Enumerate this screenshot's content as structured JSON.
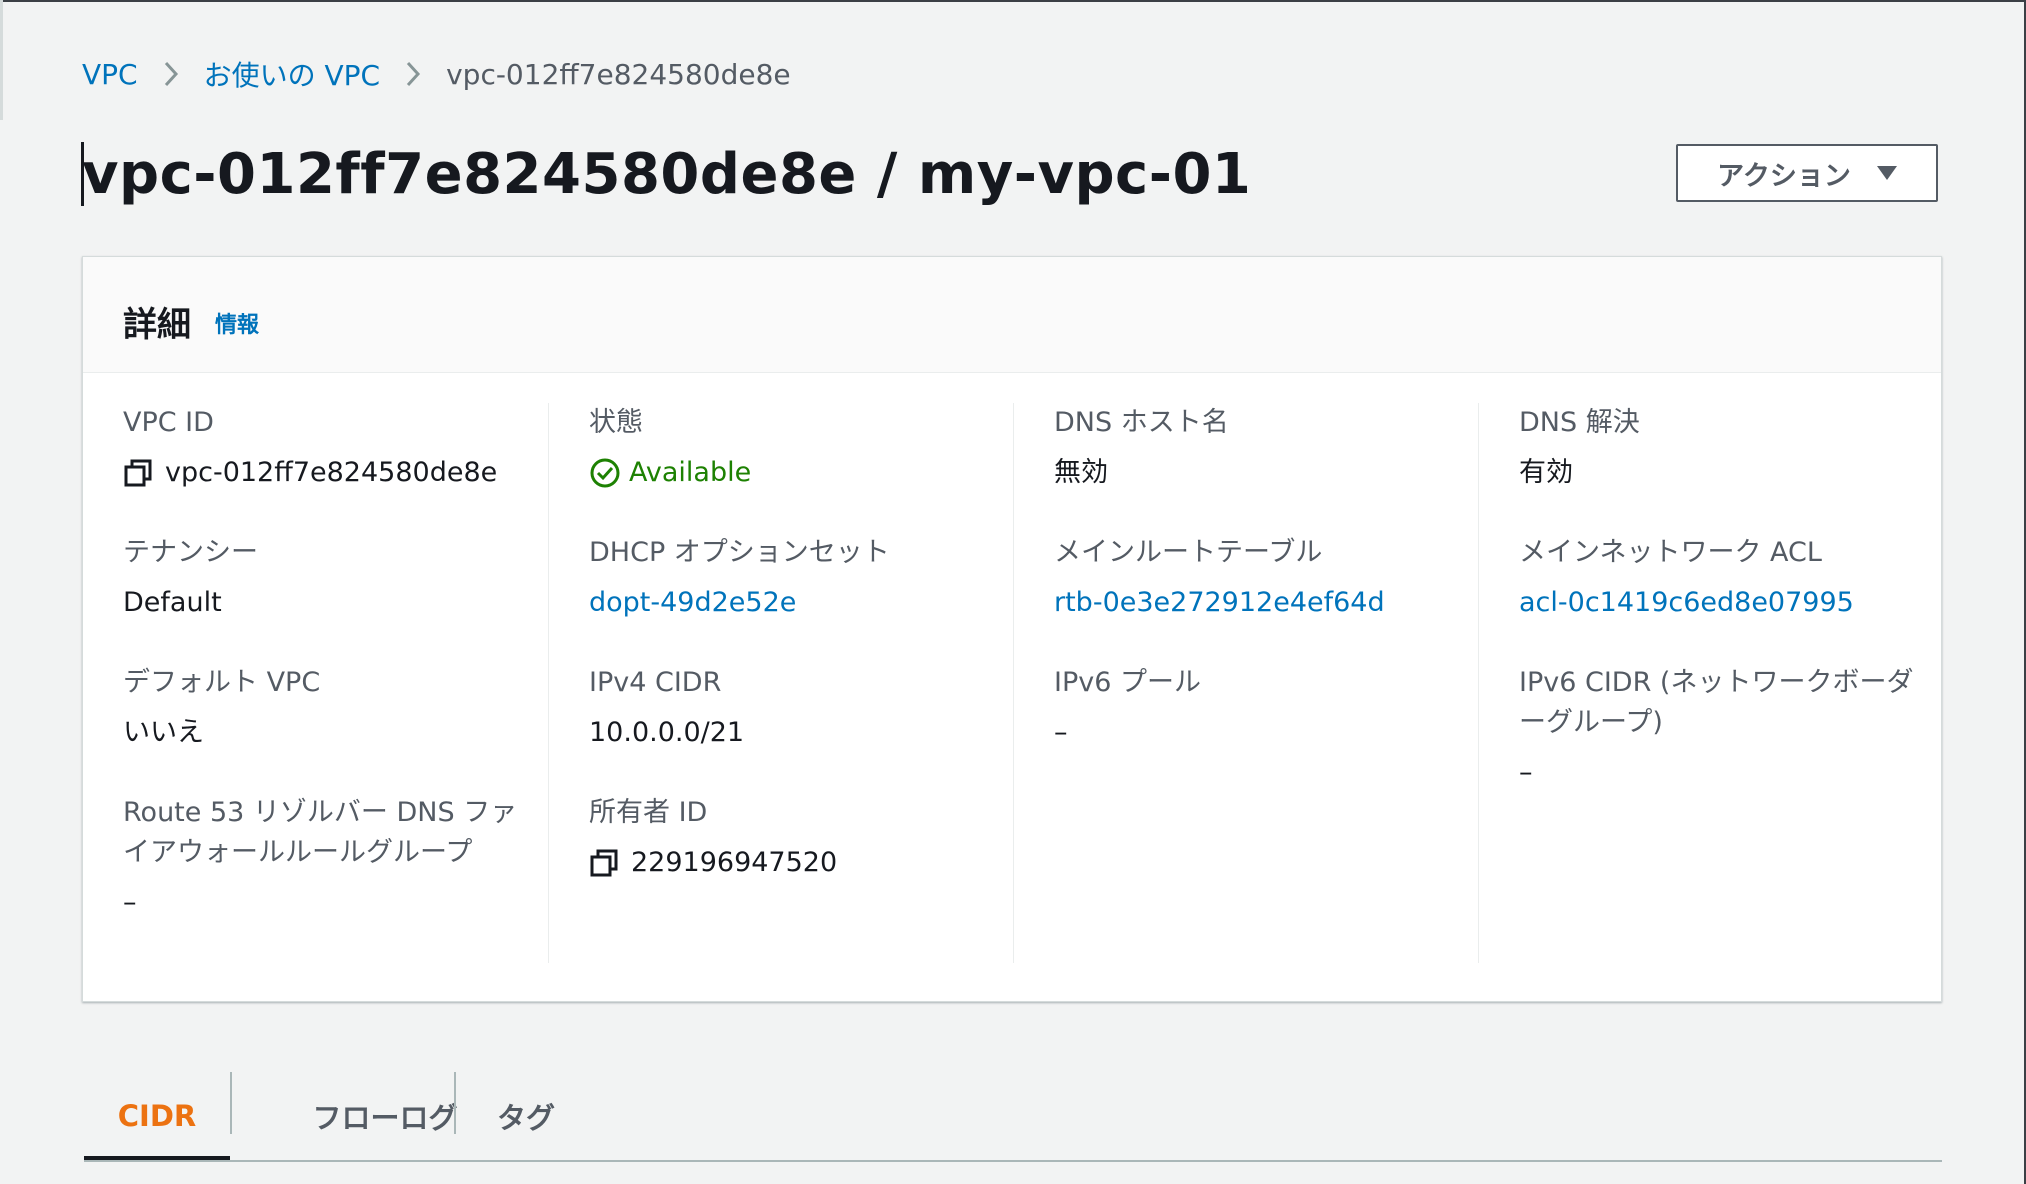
{
  "breadcrumb": {
    "items": [
      "VPC",
      "お使いの VPC"
    ],
    "current": "vpc-012ff7e824580de8e"
  },
  "page": {
    "title": "vpc-012ff7e824580de8e / my-vpc-01",
    "actions_label": "アクション"
  },
  "details": {
    "title": "詳細",
    "info_label": "情報",
    "fields": {
      "vpc_id": {
        "label": "VPC ID",
        "value": "vpc-012ff7e824580de8e"
      },
      "state": {
        "label": "状態",
        "value": "Available"
      },
      "dns_hostnames": {
        "label": "DNS ホスト名",
        "value": "無効"
      },
      "dns_resolution": {
        "label": "DNS 解決",
        "value": "有効"
      },
      "tenancy": {
        "label": "テナンシー",
        "value": "Default"
      },
      "dhcp_options": {
        "label": "DHCP オプションセット",
        "value": "dopt-49d2e52e"
      },
      "main_route_table": {
        "label": "メインルートテーブル",
        "value": "rtb-0e3e272912e4ef64d"
      },
      "main_network_acl": {
        "label": "メインネットワーク ACL",
        "value": "acl-0c1419c6ed8e07995"
      },
      "default_vpc": {
        "label": "デフォルト VPC",
        "value": "いいえ"
      },
      "ipv4_cidr": {
        "label": "IPv4 CIDR",
        "value": "10.0.0.0/21"
      },
      "ipv6_pool": {
        "label": "IPv6 プール",
        "value": "–"
      },
      "ipv6_cidr": {
        "label": "IPv6 CIDR (ネットワークボーダーグループ)",
        "value": "–"
      },
      "route53_firewall": {
        "label": "Route 53 リゾルバー DNS ファイアウォールルールグループ",
        "value": "–"
      },
      "owner_id": {
        "label": "所有者 ID",
        "value": "229196947520"
      }
    }
  },
  "tabs": [
    {
      "label": "CIDR",
      "active": true
    },
    {
      "label": "フローログ",
      "active": false
    },
    {
      "label": "タグ",
      "active": false
    }
  ],
  "colors": {
    "link": "#0073bb",
    "status_ok": "#1d8102",
    "active_tab": "#ec7211",
    "background": "#f2f3f3"
  }
}
